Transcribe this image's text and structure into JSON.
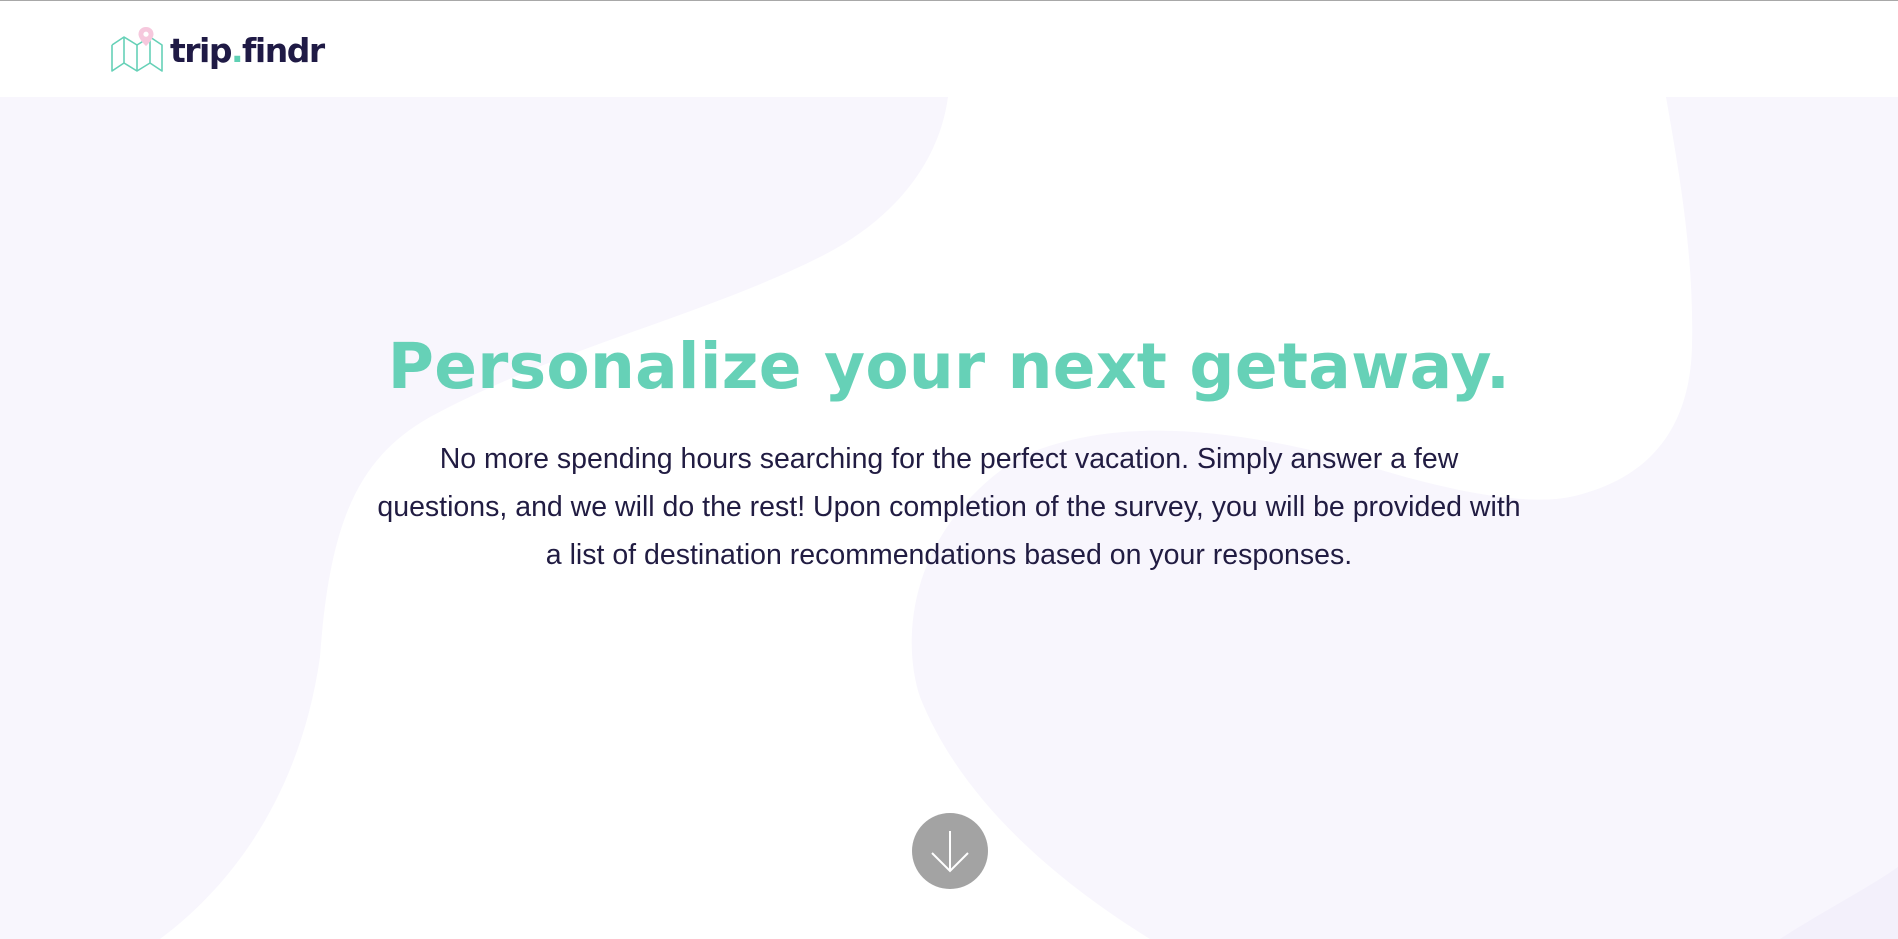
{
  "header": {
    "logo": {
      "text_main": "trip",
      "text_dot": ".",
      "text_tail": "findr",
      "icon": "map-pin-icon"
    }
  },
  "hero": {
    "headline": "Personalize your next getaway.",
    "intro": "No more spending hours searching for the perfect vacation. Simply answer a few questions, and we will do the rest! Upon completion of the survey, you will be provided with a list of destination recommendations based on your responses.",
    "scroll_button": {
      "icon": "arrow-down-icon"
    }
  },
  "colors": {
    "brand_teal": "#66d1b7",
    "brand_navy": "#1f1a45",
    "pin_pink": "#f6c8dd",
    "blob_lavender": "#f8f6fd",
    "button_gray": "#a3a3a3"
  }
}
